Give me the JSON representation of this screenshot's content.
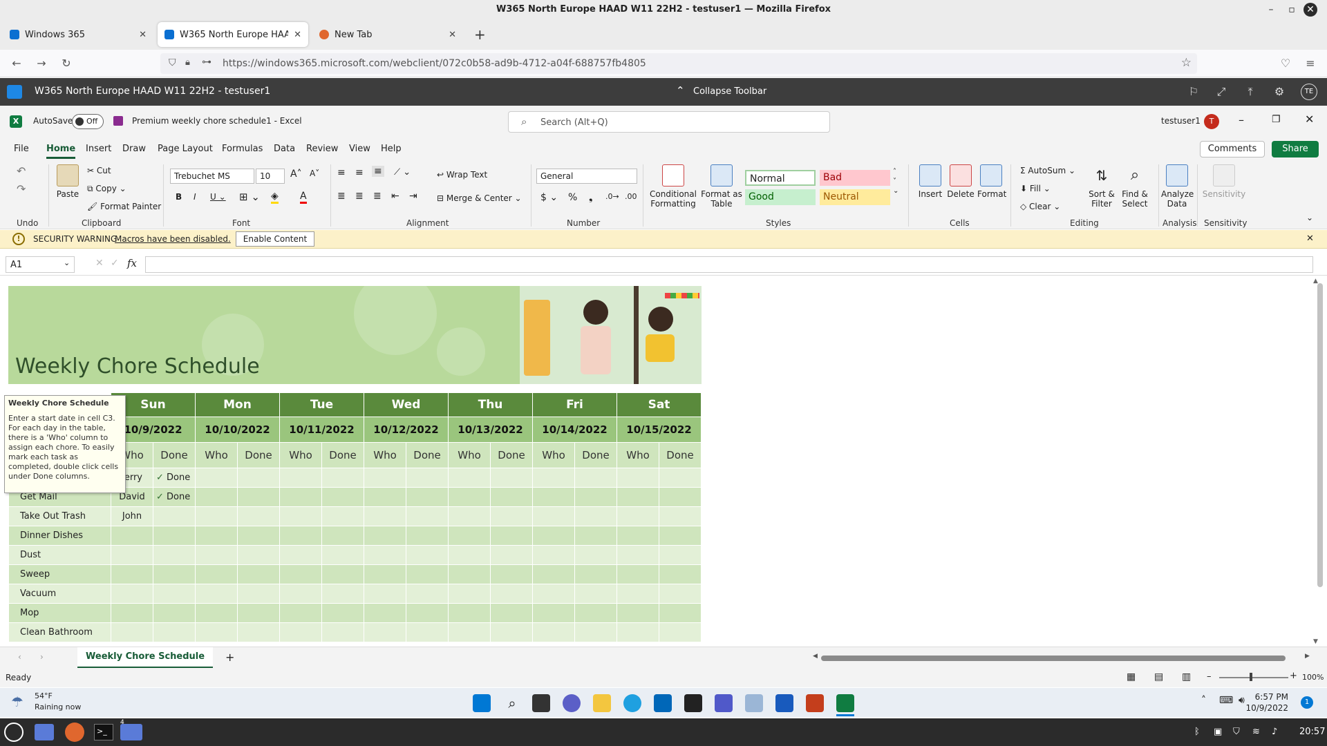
{
  "firefox": {
    "window_title": "W365 North Europe HAAD W11 22H2 - testuser1 — Mozilla Firefox",
    "tabs": [
      {
        "label": "Windows 365",
        "active": false
      },
      {
        "label": "W365 North Europe HAAD W11 22H2 - testuser1",
        "active": true
      },
      {
        "label": "New Tab",
        "active": false
      }
    ],
    "url": "https://windows365.microsoft.com/webclient/072c0b58-ad9b-4712-a04f-688757fb4805"
  },
  "w365": {
    "title": "W365 North Europe HAAD W11 22H2 - testuser1",
    "collapse_label": "Collapse Toolbar",
    "avatar": "TE"
  },
  "excel": {
    "autosave_label": "AutoSave",
    "autosave_state": "Off",
    "doc_title": "Premium weekly chore schedule1  -  Excel",
    "search_placeholder": "Search (Alt+Q)",
    "user": "testuser1",
    "user_initial": "T",
    "ribbon_tabs": [
      "File",
      "Home",
      "Insert",
      "Draw",
      "Page Layout",
      "Formulas",
      "Data",
      "Review",
      "View",
      "Help"
    ],
    "comments_label": "Comments",
    "share_label": "Share",
    "clipboard": {
      "paste": "Paste",
      "cut": "Cut",
      "copy": "Copy",
      "format_painter": "Format Painter",
      "group": "Clipboard"
    },
    "undo_group": "Undo",
    "font": {
      "name": "Trebuchet MS",
      "size": "10",
      "group": "Font"
    },
    "alignment": {
      "wrap": "Wrap Text",
      "merge": "Merge & Center",
      "group": "Alignment"
    },
    "number": {
      "format": "General",
      "group": "Number"
    },
    "styles": {
      "conditional": "Conditional Formatting",
      "format_table": "Format as Table",
      "normal": "Normal",
      "bad": "Bad",
      "good": "Good",
      "neutral": "Neutral",
      "group": "Styles"
    },
    "cells": {
      "insert": "Insert",
      "delete": "Delete",
      "format": "Format",
      "group": "Cells"
    },
    "editing": {
      "autosum": "AutoSum",
      "fill": "Fill",
      "clear": "Clear",
      "sort": "Sort & Filter",
      "find": "Find & Select",
      "group": "Editing"
    },
    "analysis": {
      "analyze": "Analyze Data",
      "group": "Analysis"
    },
    "sensitivity": {
      "label": "Sensitivity",
      "group": "Sensitivity"
    },
    "security": {
      "label": "SECURITY WARNING",
      "message": "Macros have been disabled.",
      "button": "Enable Content"
    },
    "name_box": "A1",
    "status": "Ready",
    "zoom": "100%",
    "sheet_tab": "Weekly Chore Schedule"
  },
  "sheet": {
    "title": "Weekly Chore Schedule",
    "days": [
      "Sun",
      "Mon",
      "Tue",
      "Wed",
      "Thu",
      "Fri",
      "Sat"
    ],
    "dates": [
      "10/9/2022",
      "10/10/2022",
      "10/11/2022",
      "10/12/2022",
      "10/13/2022",
      "10/14/2022",
      "10/15/2022"
    ],
    "who_label": "Who",
    "done_label": "Done",
    "chores": [
      {
        "name": "",
        "sun_who": "Jerry",
        "sun_done": "Done"
      },
      {
        "name": "Get Mail",
        "sun_who": "David",
        "sun_done": "Done"
      },
      {
        "name": "Take Out Trash",
        "sun_who": "John",
        "sun_done": ""
      },
      {
        "name": "Dinner Dishes",
        "sun_who": "",
        "sun_done": ""
      },
      {
        "name": "Dust",
        "sun_who": "",
        "sun_done": ""
      },
      {
        "name": "Sweep",
        "sun_who": "",
        "sun_done": ""
      },
      {
        "name": "Vacuum",
        "sun_who": "",
        "sun_done": ""
      },
      {
        "name": "Mop",
        "sun_who": "",
        "sun_done": ""
      },
      {
        "name": "Clean Bathroom",
        "sun_who": "",
        "sun_done": ""
      }
    ],
    "tooltip_title": "Weekly Chore Schedule",
    "tooltip_body": "Enter a start date in cell C3. For each day in the table, there is a 'Who' column to assign each chore. To easily mark each task as completed, double click cells under Done columns."
  },
  "taskbar": {
    "weather_temp": "54°F",
    "weather_text": "Raining now",
    "time": "6:57 PM",
    "date": "10/9/2022",
    "notification_count": "1"
  },
  "linux_panel": {
    "clock": "20:57",
    "workspace_badge": "4"
  }
}
